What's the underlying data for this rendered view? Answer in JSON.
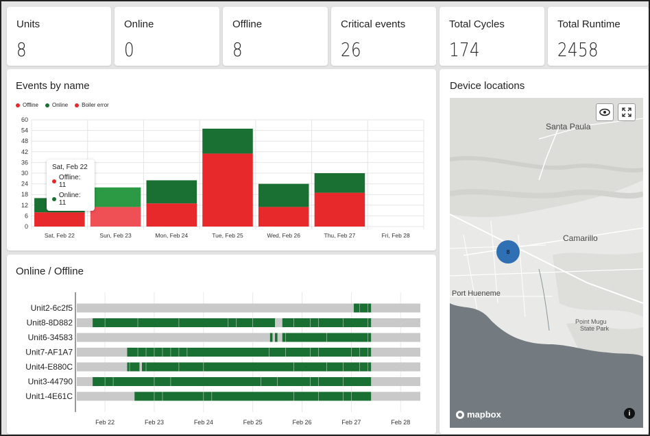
{
  "stats": [
    {
      "label": "Units",
      "value": "8"
    },
    {
      "label": "Online",
      "value": "0"
    },
    {
      "label": "Offline",
      "value": "8"
    },
    {
      "label": "Critical events",
      "value": "26"
    },
    {
      "label": "Total Cycles",
      "value": "174"
    },
    {
      "label": "Total Runtime",
      "value": "2458"
    }
  ],
  "events_panel": {
    "title": "Events by name",
    "legend": [
      {
        "name": "Offline",
        "color": "#e8292b"
      },
      {
        "name": "Online",
        "color": "#1a7033"
      },
      {
        "name": "Boiler error",
        "color": "#e8292b"
      }
    ],
    "tooltip": {
      "title": "Sat, Feb 22",
      "rows": [
        {
          "label": "Offline: 11",
          "color": "#e8292b"
        },
        {
          "label": "Online: 11",
          "color": "#1a7033"
        }
      ]
    }
  },
  "online_panel": {
    "title": "Online / Offline"
  },
  "map_panel": {
    "title": "Device locations",
    "places": [
      "Santa Paula",
      "Camarillo",
      "Port Hueneme",
      "Point Mugu",
      "State Park"
    ],
    "cluster_count": "8",
    "attribution": "mapbox",
    "colors": {
      "land": "#e9e9e7",
      "water": "#737b80",
      "cluster": "#2f6fb3"
    }
  },
  "chart_data": [
    {
      "type": "bar",
      "title": "Events by name",
      "categories": [
        "Sat, Feb 22",
        "Sun, Feb 23",
        "Mon, Feb 24",
        "Tue, Feb 25",
        "Wed, Feb 26",
        "Thu, Feb 27",
        "Fri, Feb 28"
      ],
      "series": [
        {
          "name": "Offline",
          "values": [
            8,
            11,
            13,
            41,
            11,
            19,
            0
          ],
          "color": "#e8292b"
        },
        {
          "name": "Online",
          "values": [
            8,
            11,
            13,
            14,
            13,
            11,
            0
          ],
          "color": "#1a7033"
        }
      ],
      "stacked": true,
      "ylim": [
        0,
        60
      ],
      "yticks": [
        0,
        6,
        12,
        18,
        24,
        30,
        36,
        42,
        48,
        54,
        60
      ],
      "grid": true,
      "legend_position": "top-left"
    },
    {
      "type": "timeline",
      "title": "Online / Offline",
      "x_ticks": [
        "Feb 22",
        "Feb 23",
        "Feb 24",
        "Feb 25",
        "Feb 26",
        "Feb 27",
        "Feb 28"
      ],
      "xlim": [
        21.4,
        28.4
      ],
      "rows": [
        {
          "unit": "Unit2-6c2f5",
          "online": [
            [
              27.05,
              27.4
            ]
          ]
        },
        {
          "unit": "Unit8-8D882",
          "online": [
            [
              21.75,
              25.45
            ],
            [
              25.6,
              27.4
            ]
          ]
        },
        {
          "unit": "Unit6-34583",
          "online": [
            [
              25.35,
              25.4
            ],
            [
              25.45,
              25.5
            ],
            [
              25.6,
              27.4
            ]
          ]
        },
        {
          "unit": "Unit7-AF1A7",
          "online": [
            [
              22.45,
              27.4
            ]
          ]
        },
        {
          "unit": "Unit4-E880C",
          "online": [
            [
              22.45,
              22.7
            ],
            [
              22.75,
              27.4
            ]
          ]
        },
        {
          "unit": "Unit3-44790",
          "online": [
            [
              21.75,
              27.4
            ]
          ]
        },
        {
          "unit": "Unit1-4E61C",
          "online": [
            [
              22.6,
              27.4
            ]
          ]
        }
      ],
      "colors": {
        "online": "#1a7033",
        "offline": "#c9c9c9"
      }
    }
  ]
}
